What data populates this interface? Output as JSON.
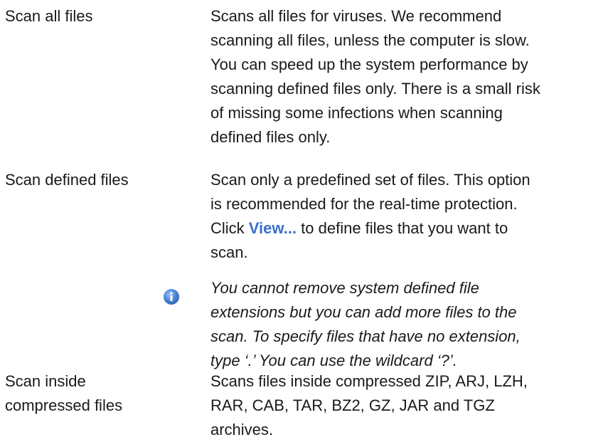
{
  "rows": [
    {
      "term": "Scan all files",
      "desc_lines": [
        "Scans all files for viruses. We recommend",
        "scanning all files, unless the computer is slow.",
        "You can speed up the system performance by",
        "scanning defined files only. There is a small risk",
        "of missing some infections when scanning",
        "defined files only."
      ]
    },
    {
      "term": "Scan defined files",
      "desc_line1": "Scan only a predefined set of files. This option",
      "desc_line2": "is recommended for the real-time protection.",
      "desc_line3_prefix": "Click ",
      "desc_line3_link": "View...",
      "desc_line3_suffix": " to define files that you want to",
      "desc_line4": "scan."
    },
    {
      "term_lines": [
        "Scan inside",
        "compressed files"
      ],
      "desc_lines": [
        "Scans files inside compressed ZIP, ARJ, LZH,",
        "RAR, CAB, TAR, BZ2, GZ, JAR and TGZ",
        "archives."
      ]
    }
  ],
  "note": {
    "icon": "info-icon",
    "lines": [
      "You cannot remove system defined file",
      "extensions but you can add more files to the",
      "scan. To specify files that have no extension,",
      "type ‘.’ You can use the wildcard ‘?’."
    ]
  },
  "colors": {
    "text": "#1a1a1a",
    "link": "#3a6fcb",
    "icon": "#4f86d9"
  }
}
